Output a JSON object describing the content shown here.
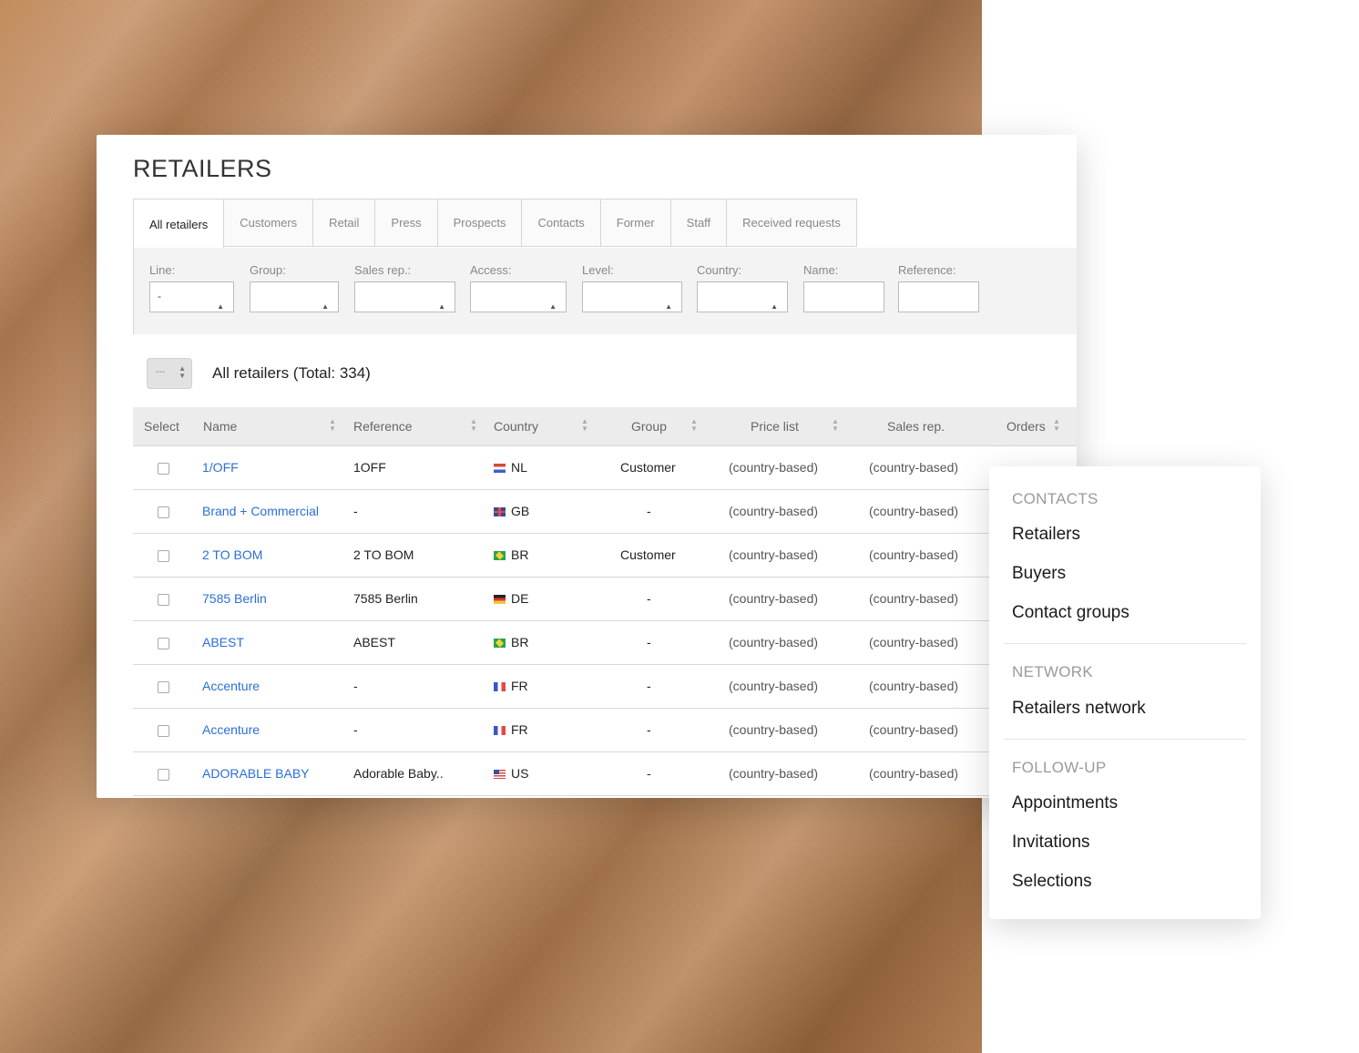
{
  "page": {
    "title": "RETAILERS"
  },
  "tabs": [
    {
      "label": "All retailers",
      "active": true
    },
    {
      "label": "Customers"
    },
    {
      "label": "Retail"
    },
    {
      "label": "Press"
    },
    {
      "label": "Prospects"
    },
    {
      "label": "Contacts"
    },
    {
      "label": "Former"
    },
    {
      "label": "Staff"
    },
    {
      "label": "Received requests"
    }
  ],
  "filters": [
    {
      "label": "Line:",
      "value": "-",
      "type": "select"
    },
    {
      "label": "Group:",
      "value": "",
      "type": "select"
    },
    {
      "label": "Sales rep.:",
      "value": "",
      "type": "select"
    },
    {
      "label": "Access:",
      "value": "",
      "type": "select"
    },
    {
      "label": "Level:",
      "value": "",
      "type": "select"
    },
    {
      "label": "Country:",
      "value": "",
      "type": "select"
    },
    {
      "label": "Name:",
      "value": "",
      "type": "text"
    },
    {
      "label": "Reference:",
      "value": "",
      "type": "text"
    }
  ],
  "list": {
    "bulk_value": "---",
    "title": "All retailers (Total: 334)"
  },
  "table": {
    "columns": [
      "Select",
      "Name",
      "Reference",
      "Country",
      "Group",
      "Price list",
      "Sales rep.",
      "Orders"
    ],
    "rows": [
      {
        "name": "1/OFF",
        "reference": "1OFF",
        "country": "NL",
        "flag": "nl",
        "group": "Customer",
        "price_list": "(country-based)",
        "sales_rep": "(country-based)"
      },
      {
        "name": "Brand + Commercial",
        "reference": "-",
        "country": "GB",
        "flag": "gb",
        "group": "-",
        "price_list": "(country-based)",
        "sales_rep": "(country-based)"
      },
      {
        "name": "2 TO BOM",
        "reference": "2 TO BOM",
        "country": "BR",
        "flag": "br",
        "group": "Customer",
        "price_list": "(country-based)",
        "sales_rep": "(country-based)"
      },
      {
        "name": "7585 Berlin",
        "reference": "7585 Berlin",
        "country": "DE",
        "flag": "de",
        "group": "-",
        "price_list": "(country-based)",
        "sales_rep": "(country-based)"
      },
      {
        "name": "ABEST",
        "reference": "ABEST",
        "country": "BR",
        "flag": "br",
        "group": "-",
        "price_list": "(country-based)",
        "sales_rep": "(country-based)"
      },
      {
        "name": "Accenture",
        "reference": "-",
        "country": "FR",
        "flag": "fr",
        "group": "-",
        "price_list": "(country-based)",
        "sales_rep": "(country-based)"
      },
      {
        "name": "Accenture",
        "reference": "-",
        "country": "FR",
        "flag": "fr",
        "group": "-",
        "price_list": "(country-based)",
        "sales_rep": "(country-based)"
      },
      {
        "name": "ADORABLE BABY",
        "reference": "Adorable Baby..",
        "country": "US",
        "flag": "us",
        "group": "-",
        "price_list": "(country-based)",
        "sales_rep": "(country-based)"
      }
    ]
  },
  "menu": {
    "sections": [
      {
        "title": "CONTACTS",
        "items": [
          "Retailers",
          "Buyers",
          "Contact groups"
        ]
      },
      {
        "title": "NETWORK",
        "items": [
          "Retailers network"
        ]
      },
      {
        "title": "FOLLOW-UP",
        "items": [
          "Appointments",
          "Invitations",
          "Selections"
        ]
      }
    ]
  },
  "colors": {
    "link": "#2b6fd6",
    "fabric": "#b67d50"
  }
}
